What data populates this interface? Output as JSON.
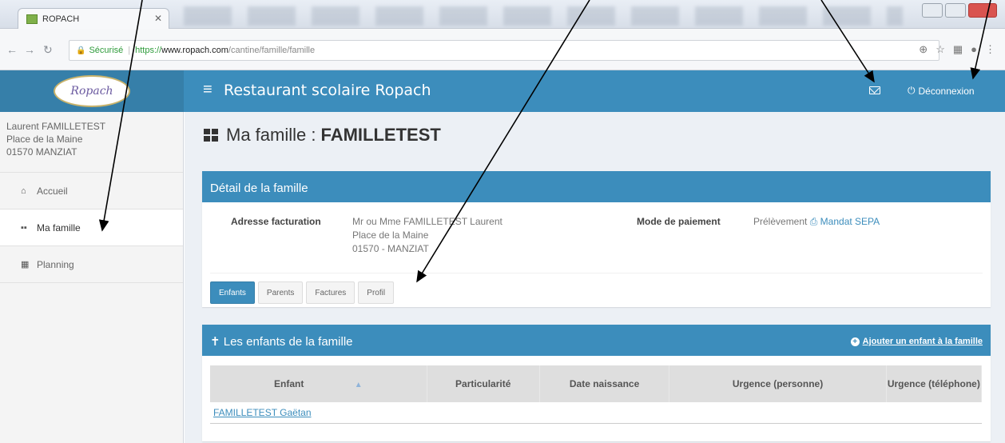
{
  "browser": {
    "tab_title": "ROPACH",
    "secure_label": "Sécurisé",
    "url_proto": "https://",
    "url_host": "www.ropach.com",
    "url_path": "/cantine/famille/famille"
  },
  "header": {
    "logo_text": "Ropach",
    "app_title": "Restaurant scolaire Ropach",
    "logout_label": "Déconnexion"
  },
  "sidebar": {
    "user_name": "Laurent FAMILLETEST",
    "user_address": "Place de la Maine",
    "user_city": "01570 MANZIAT",
    "items": [
      {
        "label": "Accueil",
        "icon": "home-icon"
      },
      {
        "label": "Ma famille",
        "icon": "grid-icon"
      },
      {
        "label": "Planning",
        "icon": "calendar-icon"
      }
    ]
  },
  "page": {
    "title_prefix": "Ma famille : ",
    "title_name": "FAMILLETEST"
  },
  "detail": {
    "header": "Détail de la famille",
    "billing_label": "Adresse facturation",
    "billing_line1": "Mr ou Mme FAMILLETEST Laurent",
    "billing_line2": "Place de la Maine",
    "billing_line3": "01570 - MANZIAT",
    "payment_label": "Mode de paiement",
    "payment_value": "Prélèvement",
    "mandate_link": "Mandat SEPA",
    "tabs": [
      "Enfants",
      "Parents",
      "Factures",
      "Profil"
    ]
  },
  "children": {
    "header": "Les enfants de la famille",
    "add_link": "Ajouter un enfant à la famille",
    "columns": [
      "Enfant",
      "Particularité",
      "Date naissance",
      "Urgence (personne)",
      "Urgence (téléphone)"
    ],
    "rows": [
      {
        "name": "FAMILLETEST Gaëtan"
      }
    ]
  },
  "colors": {
    "primary": "#3c8dbc",
    "primary_dark": "#367fa9",
    "background": "#ecf0f5"
  }
}
